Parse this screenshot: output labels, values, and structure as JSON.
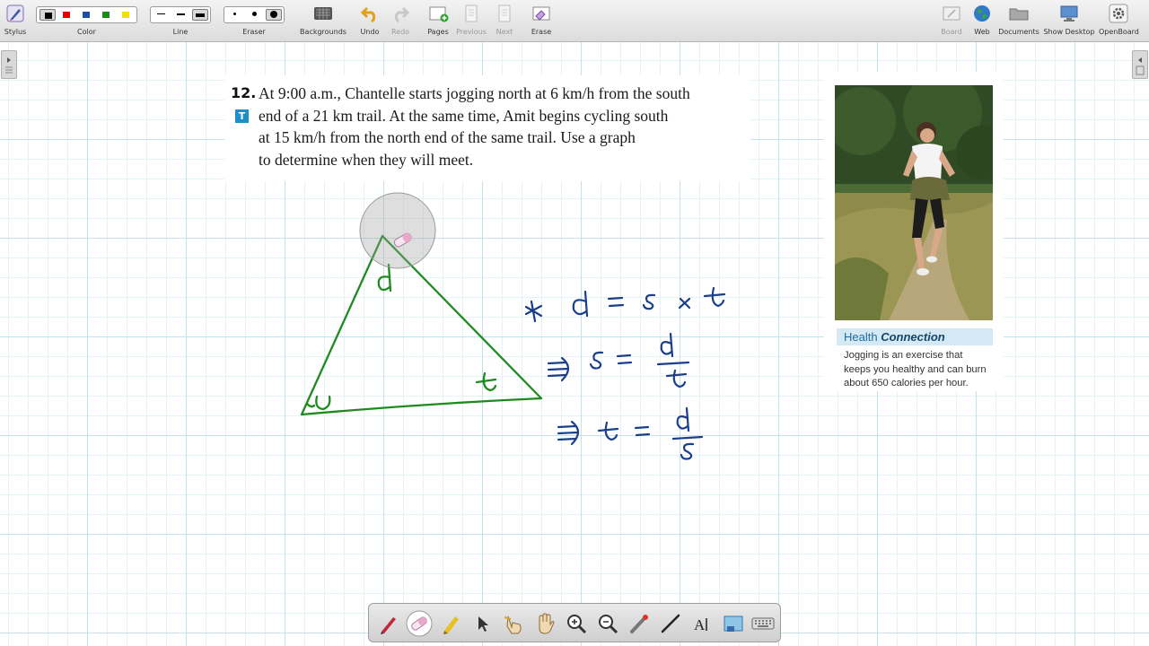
{
  "toolbar": {
    "stylus": "Stylus",
    "color": "Color",
    "line": "Line",
    "eraser": "Eraser",
    "backgrounds": "Backgrounds",
    "undo": "Undo",
    "redo": "Redo",
    "pages": "Pages",
    "previous": "Previous",
    "next": "Next",
    "erase": "Erase",
    "board": "Board",
    "web": "Web",
    "documents": "Documents",
    "show_desktop": "Show Desktop",
    "openboard": "OpenBoard",
    "colors": [
      "#000000",
      "#e00000",
      "#1c4fa8",
      "#1a8a1a",
      "#f2e100"
    ]
  },
  "question": {
    "number": "12.",
    "badge": "T",
    "lines": [
      "At 9:00 a.m., Chantelle starts jogging north at 6 km/h from the south",
      "end of a 21 km trail. At the same time, Amit begins cycling south",
      "at 15 km/h from the north end of the same trail. Use a graph",
      "to determine when they will meet."
    ]
  },
  "side_panel": {
    "title_plain": "Health ",
    "title_emph": "Connection",
    "body_lines": [
      "Jogging is an exercise that",
      "keeps you healthy and can burn",
      "about 650 calories per hour."
    ]
  },
  "handwriting": {
    "triangle_top": "d",
    "triangle_left": "s",
    "triangle_right": "t",
    "formula1": "d = s × t",
    "formula2": "⇒ s = d / t",
    "formula3": "⇒ t = d / s",
    "ink_green": "#1f8a1f",
    "ink_blue": "#1a3e8a"
  },
  "bottom_toolbar": {
    "tools": [
      "pen-tool",
      "eraser-tool",
      "marker-tool",
      "selector-tool",
      "interact-tool",
      "hand-tool",
      "zoom-in-tool",
      "zoom-out-tool",
      "laser-pointer-tool",
      "line-tool",
      "text-tool",
      "capture-tool",
      "virtual-keyboard-tool"
    ]
  }
}
